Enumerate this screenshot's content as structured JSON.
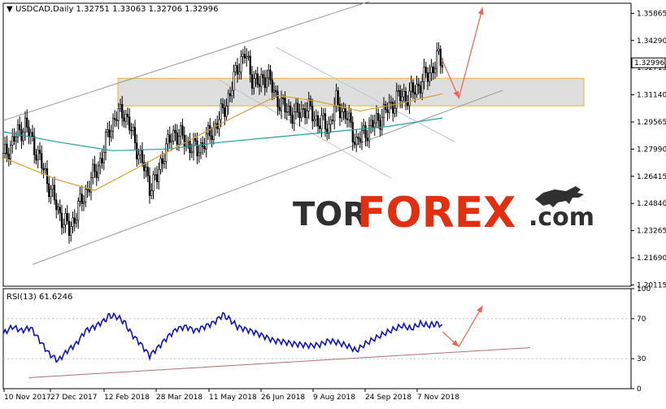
{
  "chart_header": "USDCAD,Daily  1.32751 1.33063 1.32706 1.32996",
  "watermark": {
    "tor": "TOR",
    "forex": "FOREX",
    "com": ".com"
  },
  "colors": {
    "background": "#ffffff",
    "candle": "#000000",
    "ma_slow": "#20a0a0",
    "ma_fast": "#d8a030",
    "channel": "#9a9a9a",
    "channel_light": "#b8c4d0",
    "zone_fill": "#d8d8d8",
    "zone_border": "#f0b040",
    "arrow": "#f06050",
    "rsi": "#1010c0",
    "rsi_trend": "#b07070",
    "brand_red": "#e03010",
    "brand_dark": "#303030"
  },
  "chart_data": [
    {
      "type": "candlestick",
      "symbol": "USDCAD",
      "timeframe": "Daily",
      "ohlc": {
        "open": 1.32751,
        "high": 1.33063,
        "low": 1.32706,
        "close": 1.32996
      },
      "ylim": [
        1.2004,
        1.3645
      ],
      "y_ticks": [
        "1.35865",
        "1.34290",
        "1.32715",
        "1.31140",
        "1.29565",
        "1.27990",
        "1.26415",
        "1.24840",
        "1.23265",
        "1.21690",
        "1.20115"
      ],
      "current_price_label": "1.32996",
      "current_price": 1.32996,
      "x_ticks": [
        "10 Nov 2017",
        "27 Dec 2017",
        "12 Feb 2018",
        "28 Mar 2018",
        "11 May 2018",
        "26 Jun 2018",
        "9 Aug 2018",
        "24 Sep 2018",
        "7 Nov 2018"
      ],
      "approx_close_path": [
        [
          0,
          1.275
        ],
        [
          6,
          1.286
        ],
        [
          12,
          1.294
        ],
        [
          18,
          1.279
        ],
        [
          24,
          1.262
        ],
        [
          30,
          1.244
        ],
        [
          36,
          1.233
        ],
        [
          42,
          1.248
        ],
        [
          48,
          1.262
        ],
        [
          54,
          1.275
        ],
        [
          58,
          1.292
        ],
        [
          62,
          1.299
        ],
        [
          66,
          1.302
        ],
        [
          70,
          1.29
        ],
        [
          76,
          1.272
        ],
        [
          80,
          1.259
        ],
        [
          84,
          1.263
        ],
        [
          88,
          1.279
        ],
        [
          94,
          1.29
        ],
        [
          100,
          1.284
        ],
        [
          106,
          1.279
        ],
        [
          112,
          1.287
        ],
        [
          118,
          1.297
        ],
        [
          124,
          1.312
        ],
        [
          128,
          1.328
        ],
        [
          132,
          1.335
        ],
        [
          136,
          1.322
        ],
        [
          140,
          1.317
        ],
        [
          144,
          1.324
        ],
        [
          148,
          1.312
        ],
        [
          154,
          1.303
        ],
        [
          160,
          1.3
        ],
        [
          166,
          1.304
        ],
        [
          172,
          1.296
        ],
        [
          178,
          1.293
        ],
        [
          182,
          1.307
        ],
        [
          188,
          1.298
        ],
        [
          193,
          1.284
        ],
        [
          198,
          1.29
        ],
        [
          204,
          1.296
        ],
        [
          210,
          1.303
        ],
        [
          216,
          1.31
        ],
        [
          222,
          1.311
        ],
        [
          228,
          1.318
        ],
        [
          234,
          1.326
        ],
        [
          238,
          1.333
        ],
        [
          240,
          1.331
        ]
      ],
      "moving_averages": [
        {
          "period": "slow",
          "points": [
            [
              0,
              1.29
            ],
            [
              30,
              1.284
            ],
            [
              60,
              1.279
            ],
            [
              90,
              1.28
            ],
            [
              120,
              1.284
            ],
            [
              150,
              1.287
            ],
            [
              180,
              1.29
            ],
            [
              210,
              1.293
            ],
            [
              240,
              1.298
            ]
          ]
        },
        {
          "period": "fast",
          "points": [
            [
              0,
              1.275
            ],
            [
              30,
              1.262
            ],
            [
              50,
              1.256
            ],
            [
              75,
              1.27
            ],
            [
              100,
              1.284
            ],
            [
              125,
              1.298
            ],
            [
              150,
              1.311
            ],
            [
              170,
              1.308
            ],
            [
              195,
              1.302
            ],
            [
              215,
              1.306
            ],
            [
              240,
              1.312
            ]
          ]
        }
      ],
      "resistance_zone": [
        1.305,
        1.321
      ],
      "forecast_arrow": [
        [
          240,
          1.3315
        ],
        [
          249,
          1.3095
        ],
        [
          262,
          1.362
        ]
      ],
      "trend_channel": {
        "lower": [
          [
            16,
            1.213
          ],
          [
            273,
            1.314
          ]
        ],
        "upper": [
          [
            0,
            1.2965
          ],
          [
            200,
            1.3655
          ]
        ]
      },
      "correction_channel": {
        "upper": [
          [
            149,
            1.339
          ],
          [
            247,
            1.284
          ]
        ],
        "lower": [
          [
            118,
            1.32
          ],
          [
            212,
            1.263
          ]
        ]
      }
    },
    {
      "type": "line",
      "series": [
        {
          "name": "RSI(13)",
          "points": [
            [
              0,
              55
            ],
            [
              5,
              62
            ],
            [
              10,
              58
            ],
            [
              15,
              61
            ],
            [
              20,
              48
            ],
            [
              25,
              35
            ],
            [
              30,
              28
            ],
            [
              35,
              38
            ],
            [
              40,
              45
            ],
            [
              45,
              58
            ],
            [
              50,
              62
            ],
            [
              55,
              68
            ],
            [
              58,
              73
            ],
            [
              62,
              72
            ],
            [
              66,
              67
            ],
            [
              70,
              55
            ],
            [
              75,
              45
            ],
            [
              80,
              33
            ],
            [
              85,
              42
            ],
            [
              90,
              52
            ],
            [
              95,
              60
            ],
            [
              100,
              62
            ],
            [
              105,
              58
            ],
            [
              110,
              62
            ],
            [
              115,
              66
            ],
            [
              120,
              74
            ],
            [
              124,
              69
            ],
            [
              128,
              62
            ],
            [
              133,
              59
            ],
            [
              138,
              56
            ],
            [
              143,
              52
            ],
            [
              148,
              48
            ],
            [
              153,
              47
            ],
            [
              158,
              45
            ],
            [
              163,
              44
            ],
            [
              168,
              43
            ],
            [
              173,
              44
            ],
            [
              178,
              48
            ],
            [
              183,
              46
            ],
            [
              188,
              43
            ],
            [
              193,
              38
            ],
            [
              198,
              45
            ],
            [
              203,
              50
            ],
            [
              208,
              55
            ],
            [
              213,
              59
            ],
            [
              218,
              63
            ],
            [
              223,
              60
            ],
            [
              228,
              65
            ],
            [
              233,
              63
            ],
            [
              236,
              65
            ],
            [
              240,
              64
            ]
          ]
        }
      ],
      "header_label": "RSI(13) 61.6246",
      "ylim": [
        0,
        100
      ],
      "y_ticks": [
        {
          "value": 100,
          "label": "100"
        },
        {
          "value": 70,
          "label": "70"
        },
        {
          "value": 30,
          "label": "30"
        },
        {
          "value": 0,
          "label": "0"
        }
      ],
      "levels": [
        70,
        30
      ],
      "trend_line": [
        [
          14,
          11
        ],
        [
          288,
          41
        ]
      ],
      "forecast_arrow": [
        [
          240,
          57
        ],
        [
          249,
          42
        ],
        [
          262,
          83
        ]
      ]
    }
  ]
}
